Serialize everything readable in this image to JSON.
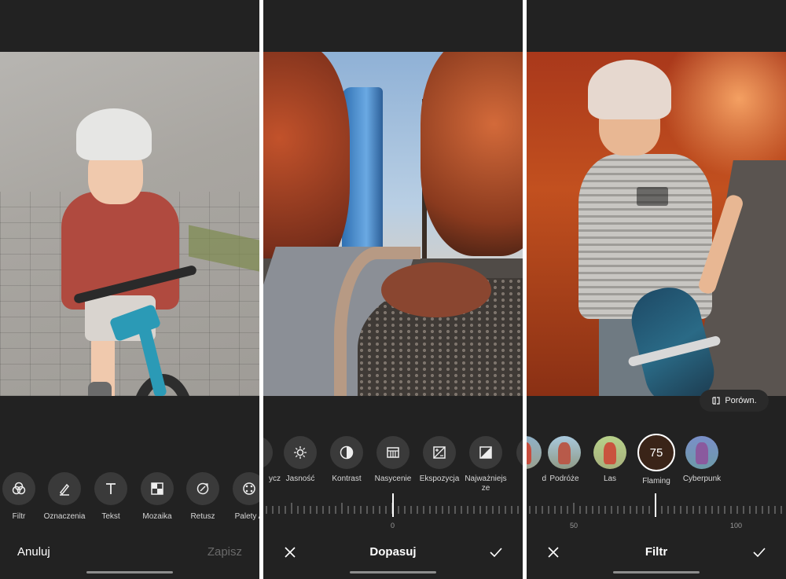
{
  "screens": [
    {
      "id": "edit",
      "tools": [
        {
          "label": "Filtr",
          "icon": "filter-icon"
        },
        {
          "label": "Oznaczenia",
          "icon": "pen-icon"
        },
        {
          "label": "Tekst",
          "icon": "text-icon"
        },
        {
          "label": "Mozaika",
          "icon": "mosaic-icon"
        },
        {
          "label": "Retusz",
          "icon": "retouch-icon"
        },
        {
          "label": "Palety A",
          "icon": "palette-icon"
        }
      ],
      "cancel_label": "Anuluj",
      "save_label": "Zapisz"
    },
    {
      "id": "adjust",
      "tools": [
        {
          "label": "ycz",
          "icon": "partial-icon"
        },
        {
          "label": "Jasność",
          "icon": "brightness-icon"
        },
        {
          "label": "Kontrast",
          "icon": "contrast-icon"
        },
        {
          "label": "Nasycenie",
          "icon": "saturation-icon"
        },
        {
          "label": "Ekspozycja",
          "icon": "exposure-icon"
        },
        {
          "label": "Najważniejsze",
          "icon": "highlights-icon"
        }
      ],
      "slider": {
        "min_label": "0",
        "value": 0
      },
      "title": "Dopasuj"
    },
    {
      "id": "filter",
      "filters": [
        {
          "label": "d",
          "icon": "partial-thumb"
        },
        {
          "label": "Podróże",
          "icon": "thumb"
        },
        {
          "label": "Las",
          "icon": "thumb"
        },
        {
          "label": "Flaming",
          "icon": "thumb",
          "active": true,
          "value": "75"
        },
        {
          "label": "Cyberpunk",
          "icon": "thumb"
        }
      ],
      "slider": {
        "mid_label": "50",
        "max_label": "100",
        "value": 75
      },
      "compare_label": "Porówn.",
      "title": "Filtr"
    }
  ],
  "colors": {
    "background": "#222222",
    "button_bg": "#3a3a3a",
    "text": "#e8e8e8",
    "accent": "#ffffff"
  }
}
